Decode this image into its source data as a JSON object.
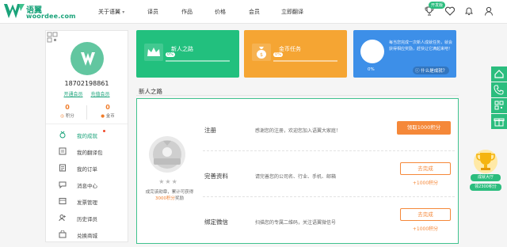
{
  "brand": {
    "name_cn": "语翼",
    "name_en": "woordee.com",
    "color": "#1aa37a"
  },
  "nav": {
    "items": [
      {
        "label": "关于语翼",
        "has_caret": true
      },
      {
        "label": "译员"
      },
      {
        "label": "作品"
      },
      {
        "label": "价格"
      },
      {
        "label": "会员"
      },
      {
        "label": "立即翻译"
      }
    ],
    "badge": "开发版",
    "icons": [
      "trophy-icon",
      "heart-icon",
      "bell-icon",
      "user-icon"
    ]
  },
  "profile": {
    "phone": "18702198861",
    "links": [
      "开通会员",
      "充值会员"
    ],
    "stats": [
      {
        "value": "0",
        "label": "积分"
      },
      {
        "value": "0",
        "label": "金币"
      }
    ]
  },
  "menu": [
    {
      "label": "我的成就",
      "icon": "medal-icon",
      "active": true,
      "dot": true
    },
    {
      "label": "我的翻译包",
      "icon": "package-icon"
    },
    {
      "label": "我的订单",
      "icon": "order-icon"
    },
    {
      "label": "消息中心",
      "icon": "message-icon"
    },
    {
      "label": "发票管理",
      "icon": "invoice-icon"
    },
    {
      "label": "历史译员",
      "icon": "translator-icon"
    },
    {
      "label": "兑换商城",
      "icon": "shop-icon"
    }
  ],
  "cards": [
    {
      "title": "新人之路",
      "pct": "0%",
      "progress": 0,
      "color": "#22c07e"
    },
    {
      "title": "金币任务",
      "pct": "0%",
      "progress": 0,
      "color": "#f5a533"
    },
    {
      "desc": "每当您完成一次新人成就任务，就会获得相应奖励，赶快让它满起来吧！",
      "pct": "0%",
      "what": "什么是成就？",
      "color": "#3d8fe8"
    }
  ],
  "section": {
    "title": "新人之路"
  },
  "medal": {
    "stars": "★★★",
    "desc_pre": "成完该勋章，累计可获得",
    "desc_hl": "3000积分",
    "desc_post": "奖励"
  },
  "tasks": [
    {
      "title": "注册",
      "desc": "感谢您的注册，欢迎您加入语翼大家庭！",
      "button": "领取1000积分"
    },
    {
      "title": "完善资料",
      "desc": "请完善您的公司名、行业、手机、邮箱",
      "button": "去完成",
      "reward": "+1000积分"
    },
    {
      "title": "绑定微信",
      "desc": "扫描您的专属二维码，关注语翼微信号",
      "button": "去完成",
      "reward": "+1000积分"
    }
  ],
  "achievement_float": {
    "label": "成就大厅",
    "sub": "领2300积分"
  }
}
